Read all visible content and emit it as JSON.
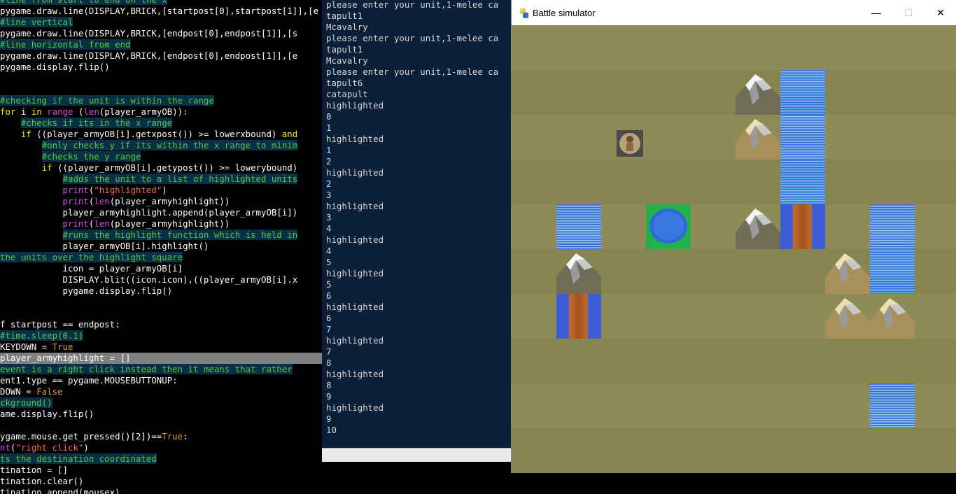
{
  "editor": {
    "lines": [
      {
        "segs": [
          [
            "cm",
            "#line from start to end on the x"
          ]
        ]
      },
      {
        "segs": [
          [
            "",
            "pygame.draw.line(DISPLAY,BRICK,[startpost[0],startpost[1]],[e"
          ]
        ]
      },
      {
        "segs": [
          [
            "cm",
            "#line vertical"
          ]
        ]
      },
      {
        "segs": [
          [
            "",
            "pygame.draw.line(DISPLAY,BRICK,[endpost[0],endpost[1]],[s"
          ]
        ]
      },
      {
        "segs": [
          [
            "cm",
            "#line horizontal from end"
          ]
        ]
      },
      {
        "segs": [
          [
            "",
            "pygame.draw.line(DISPLAY,BRICK,[endpost[0],endpost[1]],[e"
          ]
        ]
      },
      {
        "segs": [
          [
            "",
            "pygame.display.flip()"
          ]
        ]
      },
      {
        "segs": [
          [
            "",
            ""
          ]
        ]
      },
      {
        "segs": [
          [
            "",
            ""
          ]
        ]
      },
      {
        "segs": [
          [
            "cm",
            "#checking if the unit is within the range"
          ]
        ]
      },
      {
        "segs": [
          [
            "kw",
            "for"
          ],
          [
            "",
            " i "
          ],
          [
            "kw",
            "in"
          ],
          [
            "",
            " "
          ],
          [
            "bi",
            "range"
          ],
          [
            "",
            " ("
          ],
          [
            "bi",
            "len"
          ],
          [
            "",
            "(player_armyOB)):"
          ]
        ]
      },
      {
        "segs": [
          [
            "",
            "    "
          ],
          [
            "cm",
            "#checks if its in the x range"
          ]
        ]
      },
      {
        "segs": [
          [
            "",
            "    "
          ],
          [
            "kw",
            "if"
          ],
          [
            "",
            " ((player_armyOB[i].getxpost()) >= lowerxbound) "
          ],
          [
            "kw",
            "and"
          ]
        ]
      },
      {
        "segs": [
          [
            "",
            "        "
          ],
          [
            "cm",
            "#only checks y if its within the x range to minim"
          ]
        ]
      },
      {
        "segs": [
          [
            "",
            "        "
          ],
          [
            "cm",
            "#checks the y range"
          ]
        ]
      },
      {
        "segs": [
          [
            "",
            "        "
          ],
          [
            "kw",
            "if"
          ],
          [
            "",
            " ((player_armyOB[i].getypost()) >= lowerybound)"
          ]
        ]
      },
      {
        "segs": [
          [
            "",
            "            "
          ],
          [
            "cm",
            "#adds the unit to a list of highlighted units"
          ]
        ]
      },
      {
        "segs": [
          [
            "",
            "            "
          ],
          [
            "bi",
            "print"
          ],
          [
            "",
            "("
          ],
          [
            "st",
            "\"highlighted\""
          ],
          [
            "",
            ")"
          ]
        ]
      },
      {
        "segs": [
          [
            "",
            "            "
          ],
          [
            "bi",
            "print"
          ],
          [
            "",
            "("
          ],
          [
            "bi",
            "len"
          ],
          [
            "",
            "(player_armyhighlight))"
          ]
        ]
      },
      {
        "segs": [
          [
            "",
            "            player_armyhighlight.append(player_armyOB[i])"
          ]
        ]
      },
      {
        "segs": [
          [
            "",
            "            "
          ],
          [
            "bi",
            "print"
          ],
          [
            "",
            "("
          ],
          [
            "bi",
            "len"
          ],
          [
            "",
            "(player_armyhighlight))"
          ]
        ]
      },
      {
        "segs": [
          [
            "",
            "            "
          ],
          [
            "cm",
            "#runs the highlight function which is held in"
          ]
        ]
      },
      {
        "segs": [
          [
            "",
            "            player_armyOB[i].highlight()"
          ]
        ]
      },
      {
        "segs": [
          [
            "cm",
            "the units over the highlight square"
          ]
        ]
      },
      {
        "segs": [
          [
            "",
            "            icon = player_armyOB[i]"
          ]
        ]
      },
      {
        "segs": [
          [
            "",
            "            DISPLAY.blit((icon.icon),((player_armyOB[i].x"
          ]
        ]
      },
      {
        "segs": [
          [
            "",
            "            pygame.display.flip()"
          ]
        ]
      },
      {
        "segs": [
          [
            "",
            ""
          ]
        ]
      },
      {
        "segs": [
          [
            "",
            ""
          ]
        ]
      },
      {
        "segs": [
          [
            "",
            "f startpost == endpost:"
          ]
        ]
      },
      {
        "segs": [
          [
            "",
            ""
          ],
          [
            "cm",
            "#time.sleep(0.1)"
          ]
        ]
      },
      {
        "segs": [
          [
            "",
            "KEYDOWN = "
          ],
          [
            "tv",
            "True"
          ]
        ]
      },
      {
        "segs": [
          [
            "",
            "player_armyhighlight = []"
          ]
        ],
        "hl": true
      },
      {
        "segs": [
          [
            "cm",
            "event is a right click instead then it means that rather"
          ]
        ]
      },
      {
        "segs": [
          [
            "",
            "ent1.type == pygame.MOUSEBUTTONUP:"
          ]
        ]
      },
      {
        "segs": [
          [
            "",
            "DOWN = "
          ],
          [
            "tv",
            "False"
          ]
        ]
      },
      {
        "segs": [
          [
            "cm",
            "ckground()"
          ]
        ]
      },
      {
        "segs": [
          [
            "",
            "ame.display.flip()"
          ]
        ]
      },
      {
        "segs": [
          [
            "",
            ""
          ]
        ]
      },
      {
        "segs": [
          [
            "",
            "ygame.mouse.get_pressed()[2])=="
          ],
          [
            "tv",
            "True"
          ],
          [
            "",
            ":"
          ]
        ]
      },
      {
        "segs": [
          [
            "bi",
            "nt"
          ],
          [
            "",
            "("
          ],
          [
            "st",
            "\"right click\""
          ],
          [
            "",
            ")"
          ]
        ]
      },
      {
        "segs": [
          [
            "cm",
            "ts the destination coordinated"
          ]
        ]
      },
      {
        "segs": [
          [
            "",
            "tination = []"
          ]
        ]
      },
      {
        "segs": [
          [
            "",
            "tination.clear()"
          ]
        ]
      },
      {
        "segs": [
          [
            "",
            "tination.append(mousex)"
          ]
        ]
      }
    ]
  },
  "console": {
    "lines": [
      "please enter your unit,1-melee ca",
      "tapult1",
      "Mcavalry",
      "please enter your unit,1-melee ca",
      "tapult1",
      "Mcavalry",
      "please enter your unit,1-melee ca",
      "tapult6",
      "catapult",
      "highlighted",
      "0",
      "1",
      "highlighted",
      "1",
      "2",
      "highlighted",
      "2",
      "3",
      "highlighted",
      "3",
      "4",
      "highlighted",
      "4",
      "5",
      "highlighted",
      "5",
      "6",
      "highlighted",
      "6",
      "7",
      "highlighted",
      "7",
      "8",
      "highlighted",
      "8",
      "9",
      "highlighted",
      "9",
      "10"
    ]
  },
  "game": {
    "title": "Battle simulator",
    "minimize_glyph": "—",
    "maximize_glyph": "☐",
    "close_glyph": "✕",
    "terrain": [
      {
        "type": "mountain",
        "col": 5,
        "row": 1
      },
      {
        "type": "water",
        "col": 6,
        "row": 1
      },
      {
        "type": "hill",
        "col": 5,
        "row": 2
      },
      {
        "type": "water",
        "col": 6,
        "row": 2
      },
      {
        "type": "unit",
        "col": 2,
        "row": 2
      },
      {
        "type": "water",
        "col": 6,
        "row": 3
      },
      {
        "type": "water",
        "col": 1,
        "row": 4
      },
      {
        "type": "pond",
        "col": 3,
        "row": 4
      },
      {
        "type": "mountain",
        "col": 5,
        "row": 4
      },
      {
        "type": "log",
        "col": 6,
        "row": 4
      },
      {
        "type": "water",
        "col": 8,
        "row": 4
      },
      {
        "type": "mountain",
        "col": 1,
        "row": 5
      },
      {
        "type": "hill",
        "col": 7,
        "row": 5
      },
      {
        "type": "water",
        "col": 8,
        "row": 5
      },
      {
        "type": "log",
        "col": 1,
        "row": 6
      },
      {
        "type": "hill",
        "col": 7,
        "row": 6
      },
      {
        "type": "hill",
        "col": 8,
        "row": 6
      },
      {
        "type": "water",
        "col": 8,
        "row": 8
      }
    ]
  }
}
